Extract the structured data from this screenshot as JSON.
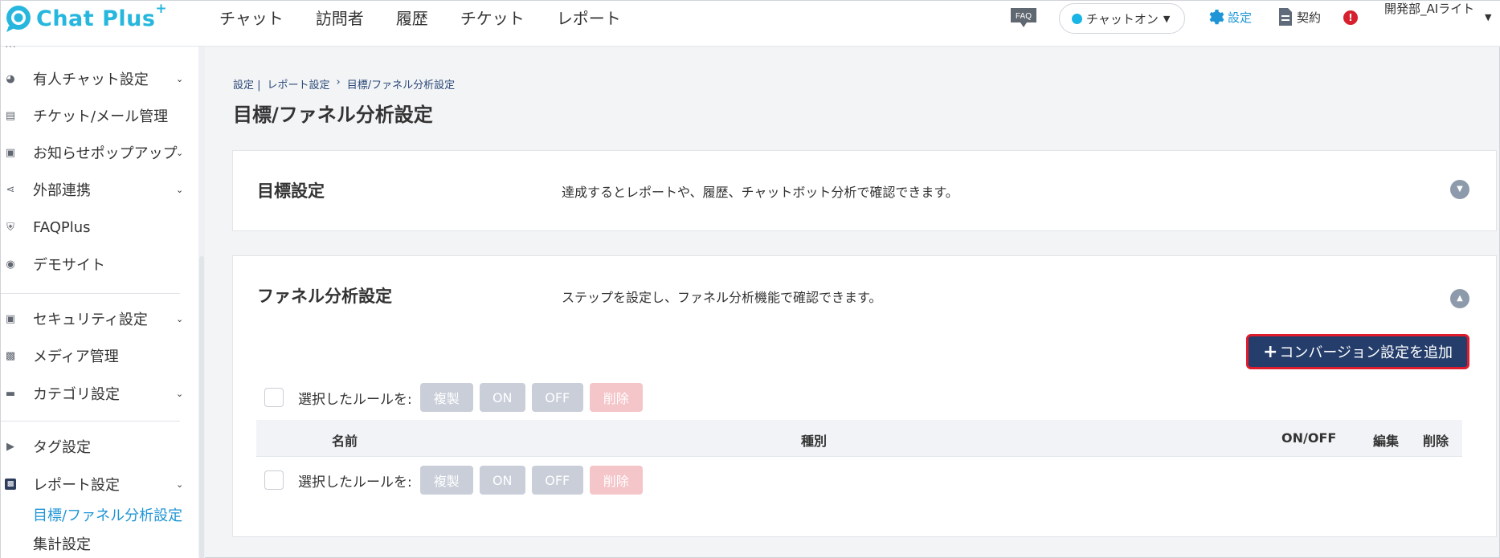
{
  "app": {
    "logo_text": "Chat Plus",
    "logo_sup": "+"
  },
  "nav": {
    "items": [
      "チャット",
      "訪問者",
      "履歴",
      "チケット",
      "レポート"
    ]
  },
  "header": {
    "faq_label": "FAQ",
    "status_label": "チャットオン",
    "settings_label": "設定",
    "contract_label": "契約",
    "alert_mark": "!",
    "user_name": "開発部_AIライト"
  },
  "sidebar": {
    "top_partial": "…",
    "items": [
      {
        "label": "有人チャット設定",
        "icon": "headset-icon",
        "has_chevron": true
      },
      {
        "label": "チケット/メール管理",
        "icon": "list-icon",
        "has_chevron": false
      },
      {
        "label": "お知らせポップアップ",
        "icon": "popup-icon",
        "has_chevron": true
      },
      {
        "label": "外部連携",
        "icon": "share-icon",
        "has_chevron": true
      },
      {
        "label": "FAQPlus",
        "icon": "faqplus-icon",
        "has_chevron": false
      },
      {
        "label": "デモサイト",
        "icon": "demo-icon",
        "has_chevron": false
      },
      {
        "label": "セキュリティ設定",
        "icon": "security-icon",
        "has_chevron": true
      },
      {
        "label": "メディア管理",
        "icon": "image-icon",
        "has_chevron": false
      },
      {
        "label": "カテゴリ設定",
        "icon": "folder-icon",
        "has_chevron": true
      },
      {
        "label": "タグ設定",
        "icon": "tag-icon",
        "has_chevron": false
      },
      {
        "label": "レポート設定",
        "icon": "chart-icon",
        "has_chevron": true
      }
    ],
    "sub_items": [
      "目標/ファネル分析設定",
      "集計設定"
    ]
  },
  "breadcrumb": [
    "設定 |",
    "レポート設定",
    "›",
    "目標/ファネル分析設定"
  ],
  "page_title": "目標/ファネル分析設定",
  "goal_card": {
    "title": "目標設定",
    "description": "達成するとレポートや、履歴、チャットボット分析で確認できます。"
  },
  "funnel_card": {
    "title": "ファネル分析設定",
    "description": "ステップを設定し、ファネル分析機能で確認できます。",
    "add_button_plus": "+",
    "add_button_label": "コンバージョン設定を追加",
    "bulk_label": "選択したルールを:",
    "bulk_buttons": [
      "複製",
      "ON",
      "OFF",
      "削除"
    ],
    "table_headers": {
      "name": "名前",
      "type": "種別",
      "onoff": "ON/OFF",
      "edit": "編集",
      "delete": "削除"
    }
  },
  "colors": {
    "brand": "#27b7de",
    "settings_link": "#1e95d6",
    "primary_button": "#243d6b",
    "highlight_border": "#e01b2c",
    "active_sub": "#1e95d6"
  }
}
